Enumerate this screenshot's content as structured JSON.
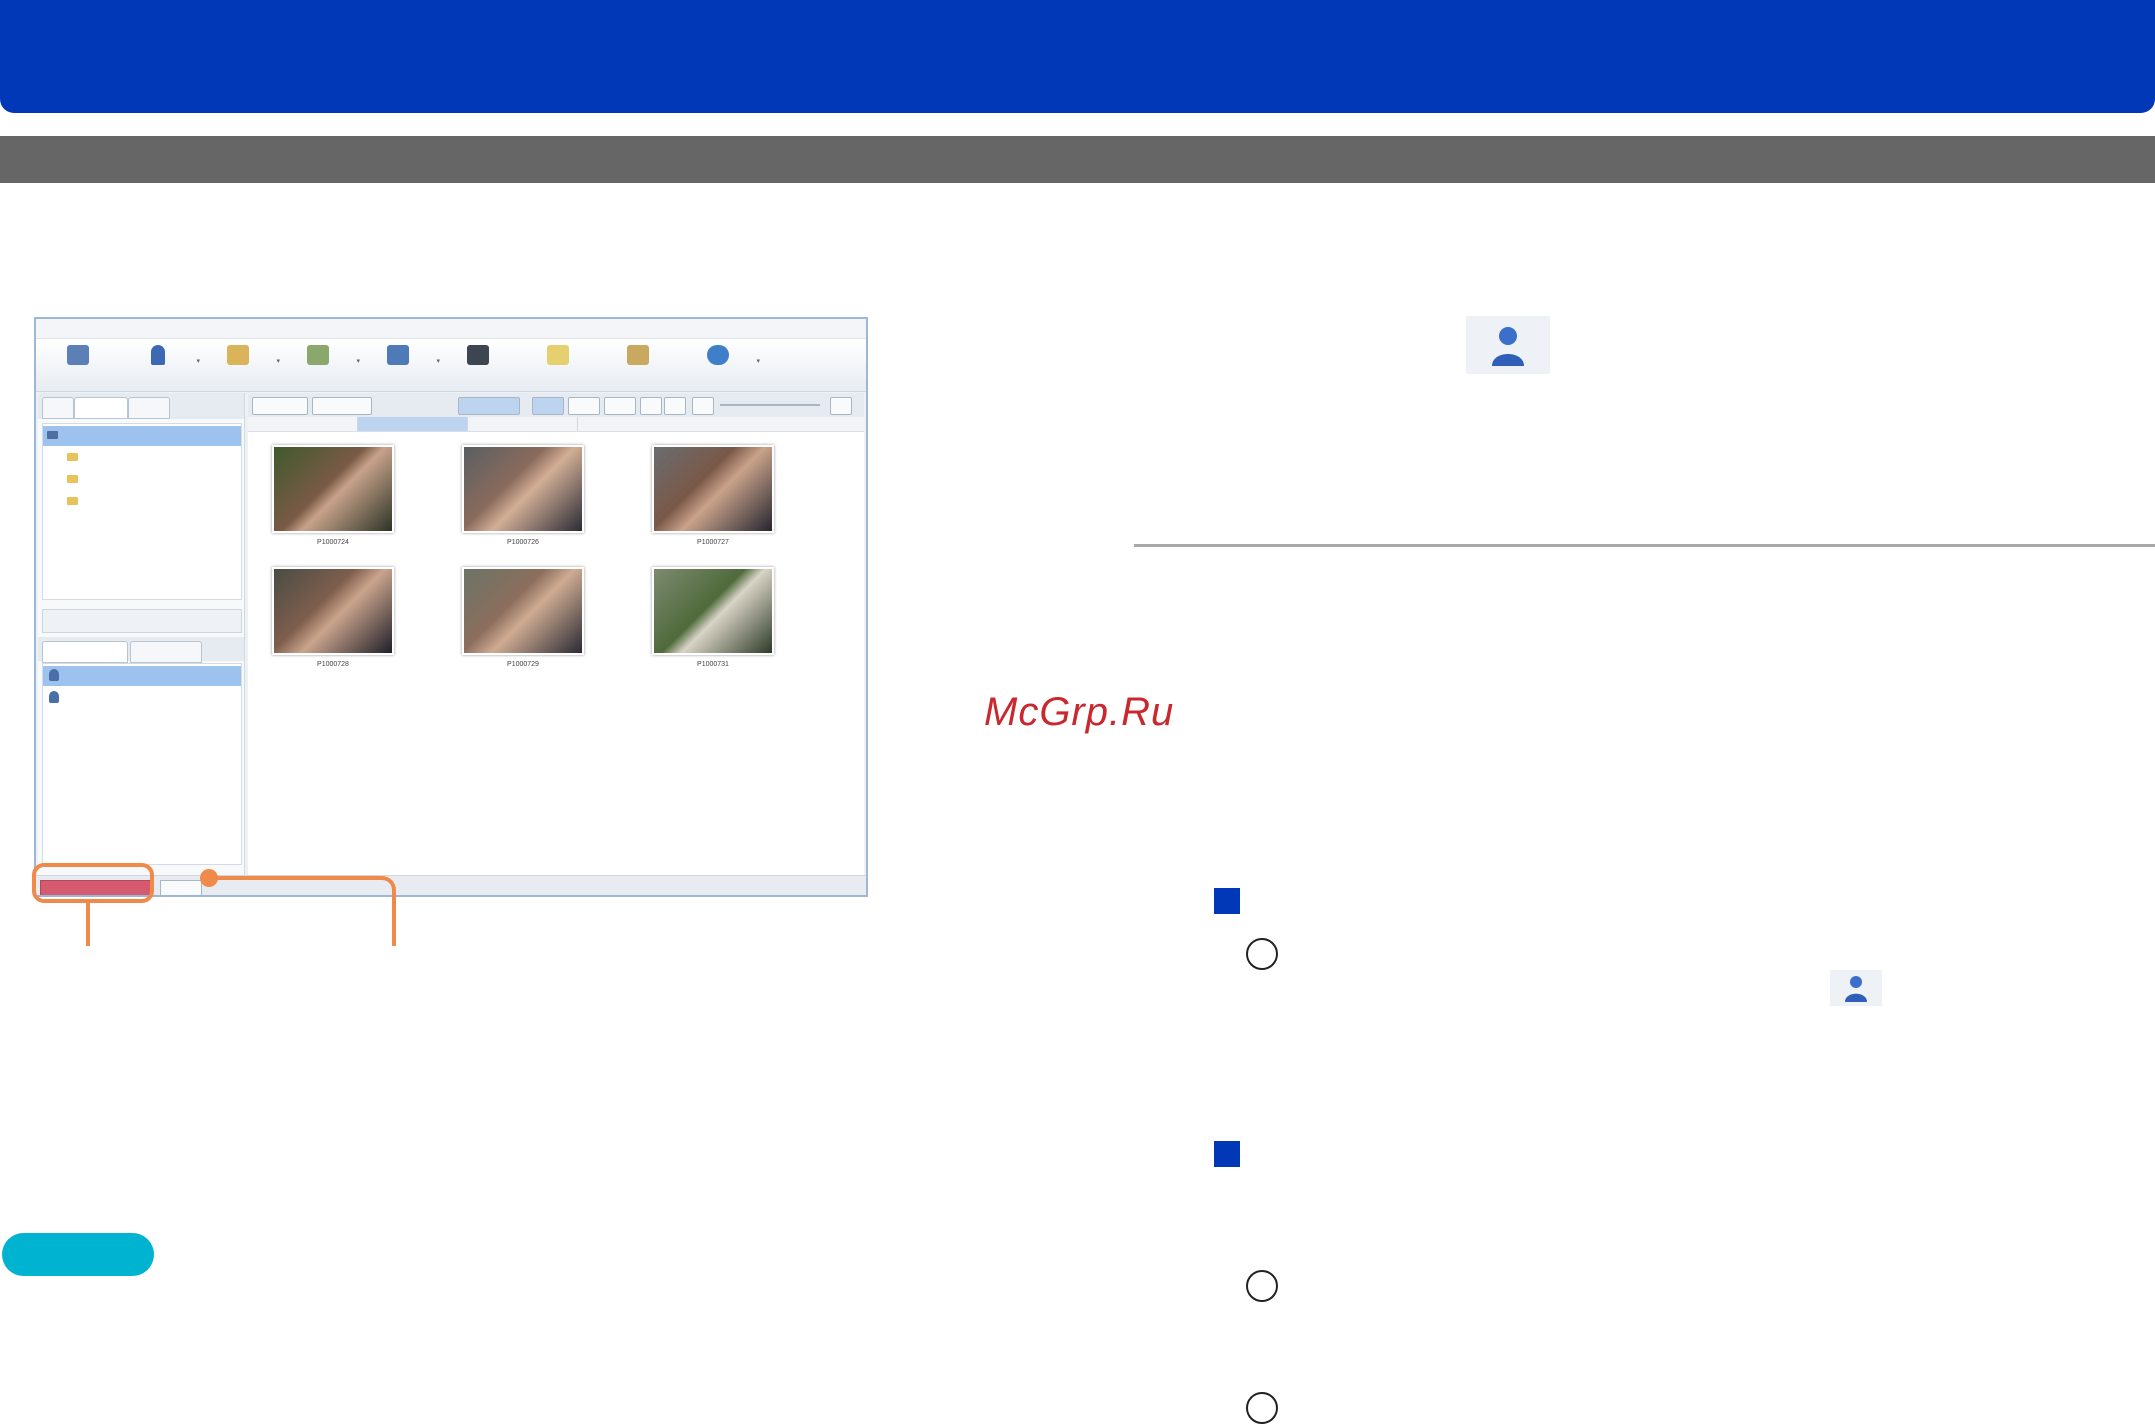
{
  "watermark": "McGrp.Ru",
  "colors": {
    "banner": "#0038b8",
    "section_bar": "#666666",
    "callout": "#f08a4b",
    "note_pill": "#00b3d1",
    "selection": "#9ec2ee"
  },
  "icons": {
    "face_recognition": "person-icon",
    "bullet": "blue-square-bullet",
    "step": "circle-step-marker"
  },
  "app_screenshot": {
    "thumbnails": [
      {
        "caption": "P1000724"
      },
      {
        "caption": "P1000726"
      },
      {
        "caption": "P1000727"
      },
      {
        "caption": "P1000728"
      },
      {
        "caption": "P1000729"
      },
      {
        "caption": "P1000731"
      }
    ]
  }
}
